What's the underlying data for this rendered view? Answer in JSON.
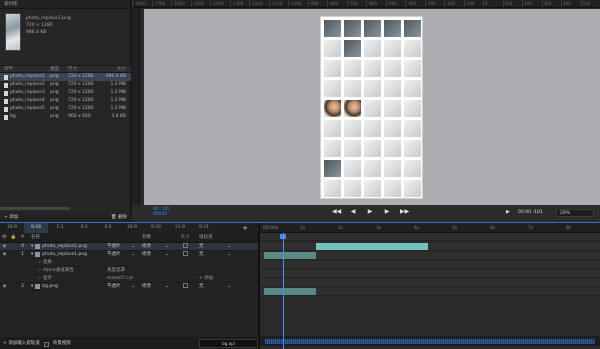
{
  "asset_panel": {
    "title": "素材库",
    "preview_info": [
      "photo_replace1.png",
      "720 × 1280",
      "986.4 KB"
    ],
    "columns": [
      "名称",
      "类型",
      "尺寸",
      "大小"
    ],
    "rows": [
      {
        "name": "photo_replace1",
        "type": "png",
        "size": "720 x 1280",
        "file": "986.4 KB",
        "selected": true
      },
      {
        "name": "photo_replace2",
        "type": "png",
        "size": "720 x 1280",
        "file": "1.3 MB",
        "selected": false
      },
      {
        "name": "photo_replace3",
        "type": "png",
        "size": "720 x 1280",
        "file": "1.3 MB",
        "selected": false
      },
      {
        "name": "photo_replace4",
        "type": "png",
        "size": "720 x 1280",
        "file": "1.3 MB",
        "selected": false
      },
      {
        "name": "photo_replace5",
        "type": "png",
        "size": "720 x 1280",
        "file": "1.3 MB",
        "selected": false
      },
      {
        "name": "bg",
        "type": "png",
        "size": "960 x 640",
        "file": "3.4 KB",
        "selected": false
      }
    ],
    "add_label": "+ 添加",
    "delete_label": "删除"
  },
  "viewer": {
    "ruler_marks": [
      "-1800",
      "-1700",
      "-1600",
      "-1500",
      "-1400",
      "-1300",
      "-1200",
      "-1100",
      "-1000",
      "-900",
      "-800",
      "-700",
      "-600",
      "-500",
      "-400",
      "-300",
      "-200",
      "-100",
      "0",
      "100",
      "200",
      "300",
      "400",
      "500"
    ],
    "timecode": "00 : 00",
    "frame": "00000",
    "controls": [
      "◀◀",
      "◀",
      "▶",
      "▶",
      "▶▶"
    ],
    "time_right": "00:00.-101",
    "zoom": "29%"
  },
  "aspect_tabs": [
    "16:9",
    "9:16",
    "1:1",
    "4:3",
    "3:4",
    "16:9",
    "9:16",
    "21:9",
    "9:21"
  ],
  "aspect_active": 1,
  "layer_table": {
    "columns": [
      "名称",
      "参数",
      "大小",
      "组轨道"
    ],
    "rows": [
      {
        "idx": "0",
        "name": "photo_replace1.png",
        "blend": "不透叶",
        "param": "修改",
        "track": "无",
        "selected": true
      },
      {
        "idx": "1",
        "name": "photo_replace1.png",
        "blend": "不透叶",
        "param": "修改",
        "track": "无",
        "selected": false
      },
      {
        "idx": "",
        "name": "变换",
        "blend": "",
        "param": "",
        "track": "",
        "selected": false
      },
      {
        "idx": "",
        "name": "Alpha通道属性",
        "blend": "真度遮罩",
        "param": "",
        "track": "",
        "selected": false
      },
      {
        "idx": "",
        "name": "名字",
        "blend": "mask07.cal",
        "param": "",
        "track": "+ 添加",
        "selected": false
      },
      {
        "idx": "2",
        "name": "bg.png",
        "blend": "不透叶",
        "param": "修改",
        "track": "无",
        "selected": false
      }
    ],
    "footer_add": "+ 添加输入遮轨道",
    "footer_bg": "背景视频"
  },
  "timeline": {
    "ruler": [
      "00:00s",
      "1s",
      "2s",
      "3s",
      "4s",
      "5s",
      "6s",
      "7s",
      "8s"
    ],
    "filename": "bg.api"
  }
}
